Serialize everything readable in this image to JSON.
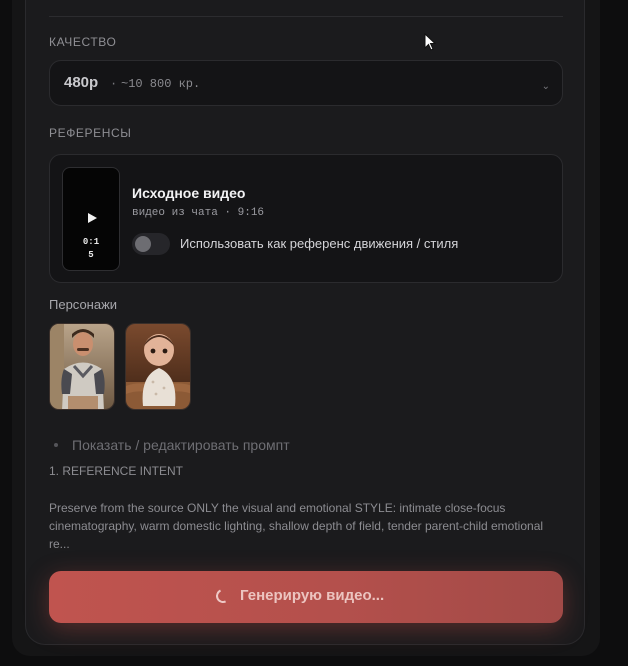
{
  "quality": {
    "label": "КАЧЕСТВО",
    "value": "480p",
    "separator": "·",
    "credits": "~10 800 кр."
  },
  "references": {
    "label": "РЕФЕРЕНСЫ",
    "video": {
      "duration": "0:15",
      "title": "Исходное видео",
      "meta": "видео из чата · 9:16",
      "toggle_label": "Использовать как референс движения / стиля",
      "toggle_on": false
    }
  },
  "characters": {
    "label": "Персонажи",
    "items": [
      {
        "name": "man"
      },
      {
        "name": "baby"
      }
    ]
  },
  "prompt": {
    "toggle_label": "Показать / редактировать промпт",
    "heading": "1. REFERENCE INTENT",
    "body": "Preserve from the source ONLY the visual and emotional STYLE: intimate close-focus cinematography, warm domestic lighting, shallow depth of field, tender parent-child emotional re..."
  },
  "generate_button": {
    "label": "Генерирую видео..."
  },
  "colors": {
    "accent": "#c0544f",
    "panel": "#1b1b1d",
    "background": "#0d0d0e"
  }
}
